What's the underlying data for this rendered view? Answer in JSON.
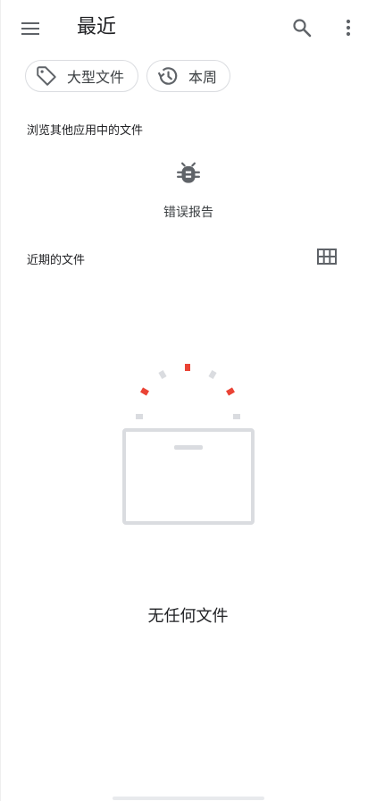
{
  "header": {
    "title": "最近",
    "menu_icon": "hamburger-menu-icon",
    "search_icon": "search-icon",
    "more_icon": "more-vert-icon"
  },
  "filters": [
    {
      "label": "大型文件",
      "icon": "label-tag-icon"
    },
    {
      "label": "本周",
      "icon": "history-icon"
    }
  ],
  "browse_section": {
    "title": "浏览其他应用中的文件",
    "apps": [
      {
        "label": "错误报告",
        "icon": "bug-report-icon"
      }
    ]
  },
  "recent_section": {
    "title": "近期的文件",
    "view_toggle_icon": "grid-view-icon"
  },
  "empty_state": {
    "message": "无任何文件",
    "illustration": "empty-box-illustration"
  },
  "colors": {
    "accent_red": "#ea4335",
    "icon_gray": "#5f6368",
    "illustration_gray": "#dadce0",
    "text_primary": "#202124"
  }
}
